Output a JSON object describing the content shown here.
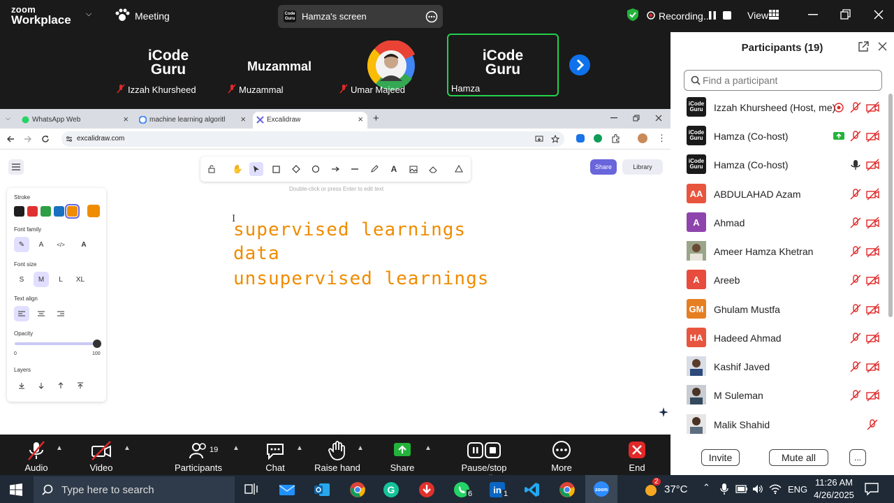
{
  "zoom": {
    "brand_line1": "zoom",
    "brand_line2": "Workplace",
    "meeting_label": "Meeting",
    "share_screen_title": "Hamza's screen",
    "recording_label": "Recording...",
    "view_label": "View"
  },
  "video_strip": {
    "tiles": [
      {
        "name": "Izzah Khursheed",
        "logo": "iCode Guru",
        "muted": true
      },
      {
        "name": "Muzammal",
        "display": "Muzammal",
        "muted": true
      },
      {
        "name": "Umar Majeed",
        "muted": true
      },
      {
        "name": "Hamza",
        "logo": "iCode Guru",
        "muted": false,
        "active": true
      }
    ],
    "logo_line1": "iCode",
    "logo_line2": "Guru"
  },
  "participants": {
    "title": "Participants (19)",
    "search_placeholder": "Find a participant",
    "list": [
      {
        "name": "Izzah Khursheed (Host, me)",
        "initials": "",
        "color": "#1a1a1a"
      },
      {
        "name": "Hamza (Co-host)",
        "initials": "",
        "color": "#1a1a1a"
      },
      {
        "name": "Hamza (Co-host)",
        "initials": "",
        "color": "#1a1a1a"
      },
      {
        "name": "ABDULAHAD Azam",
        "initials": "AA",
        "color": "#e8553f"
      },
      {
        "name": "Ahmad",
        "initials": "A",
        "color": "#8e44ad"
      },
      {
        "name": "Ameer Hamza Khetran",
        "initials": "",
        "color": "#7a8a6a"
      },
      {
        "name": "Areeb",
        "initials": "A",
        "color": "#e74c3c"
      },
      {
        "name": "Ghulam Mustfa",
        "initials": "GM",
        "color": "#e67e22"
      },
      {
        "name": "Hadeed Ahmad",
        "initials": "HA",
        "color": "#e8553f"
      },
      {
        "name": "Kashif Javed",
        "initials": "",
        "color": "#2c3e50"
      },
      {
        "name": "M Suleman",
        "initials": "",
        "color": "#34495e"
      },
      {
        "name": "Malik Shahid",
        "initials": "",
        "color": "#5d6d7e"
      }
    ],
    "invite_label": "Invite",
    "mute_all_label": "Mute all",
    "more_label": "..."
  },
  "browser": {
    "tabs": [
      {
        "title": "WhatsApp Web"
      },
      {
        "title": "machine learning algorithms - G"
      },
      {
        "title": "Excalidraw"
      }
    ],
    "url": "excalidraw.com"
  },
  "excalidraw": {
    "hint": "Double-click or press Enter to edit text",
    "share_label": "Share",
    "library_label": "Library",
    "props": {
      "stroke_label": "Stroke",
      "font_family_label": "Font family",
      "font_size_label": "Font size",
      "sizes": [
        "S",
        "M",
        "L",
        "XL"
      ],
      "text_align_label": "Text align",
      "opacity_label": "Opacity",
      "opacity_min": "0",
      "opacity_max": "100",
      "layers_label": "Layers"
    },
    "stroke_colors": [
      "#1e1e1e",
      "#e03131",
      "#2f9e44",
      "#1971c2",
      "#f08c00"
    ],
    "text_lines": [
      "supervised learnings",
      "data",
      "unsupervised learnings"
    ]
  },
  "controls": {
    "audio": "Audio",
    "video": "Video",
    "participants": "Participants",
    "participants_count": "19",
    "chat": "Chat",
    "raise_hand": "Raise hand",
    "share": "Share",
    "recording": "Pause/stop recording",
    "more": "More",
    "end": "End"
  },
  "taskbar": {
    "search_placeholder": "Type here to search",
    "temperature": "37°C",
    "language": "ENG",
    "time": "11:26 AM",
    "date": "4/26/2025",
    "whatsapp_badge": "6",
    "linkedin_badge": "1",
    "weather_badge": "2"
  }
}
